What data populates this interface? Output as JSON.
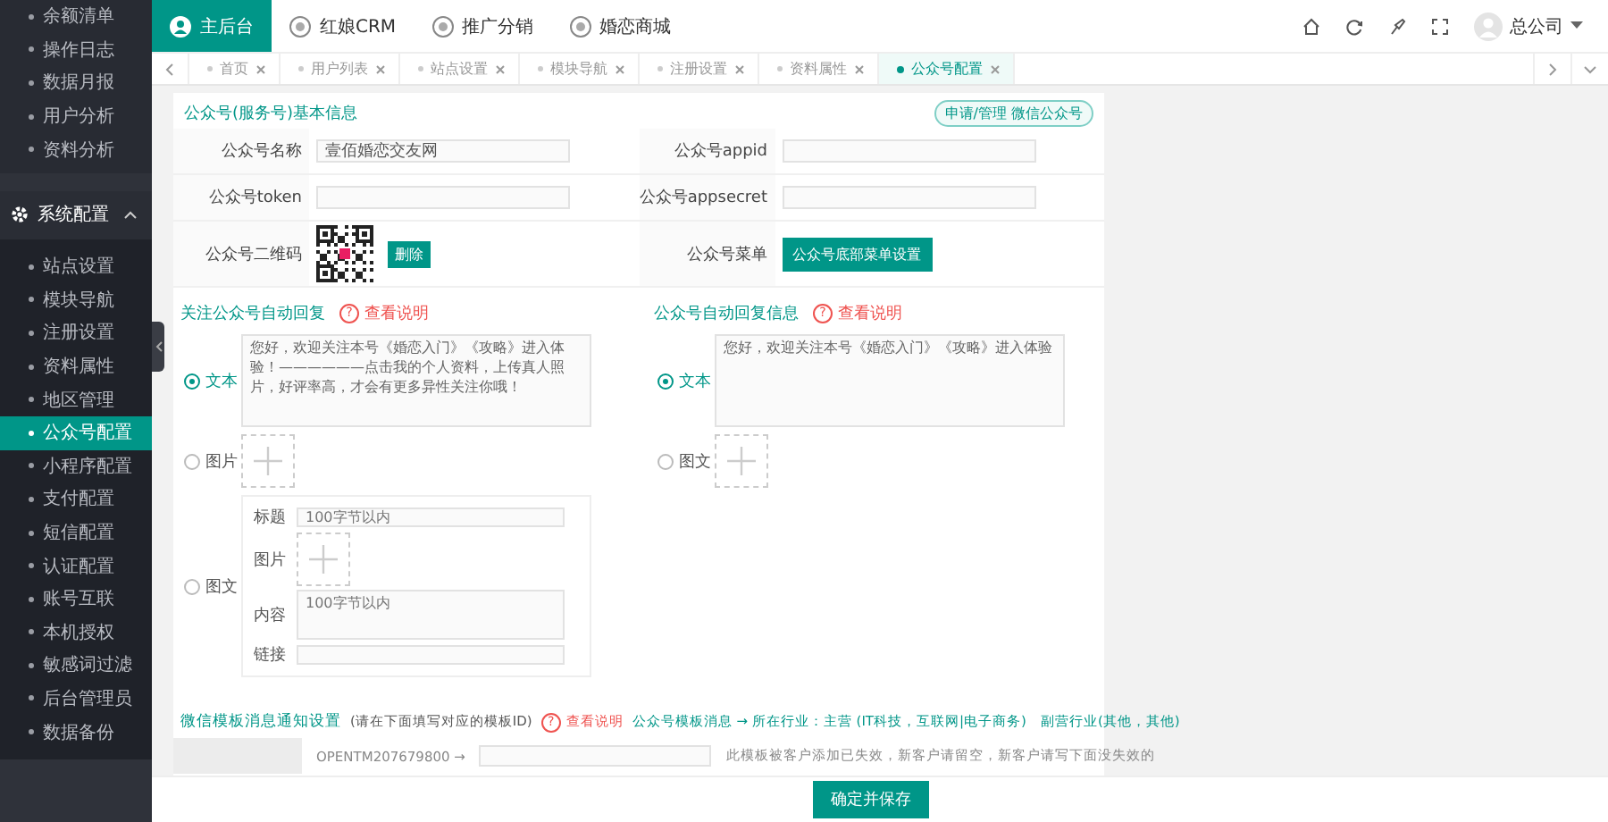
{
  "sidebar": {
    "items": [
      {
        "label": "余额清单",
        "selected": false
      },
      {
        "label": "操作日志",
        "selected": false
      },
      {
        "label": "数据月报",
        "selected": false
      },
      {
        "label": "用户分析",
        "selected": false
      },
      {
        "label": "资料分析",
        "selected": false
      }
    ],
    "section": {
      "label": "系统配置",
      "expanded": true,
      "children": [
        {
          "label": "站点设置",
          "selected": false
        },
        {
          "label": "模块导航",
          "selected": false
        },
        {
          "label": "注册设置",
          "selected": false
        },
        {
          "label": "资料属性",
          "selected": false
        },
        {
          "label": "地区管理",
          "selected": false
        },
        {
          "label": "公众号配置",
          "selected": true
        },
        {
          "label": "小程序配置",
          "selected": false
        },
        {
          "label": "支付配置",
          "selected": false
        },
        {
          "label": "短信配置",
          "selected": false
        },
        {
          "label": "认证配置",
          "selected": false
        },
        {
          "label": "账号互联",
          "selected": false
        },
        {
          "label": "本机授权",
          "selected": false
        },
        {
          "label": "敏感词过滤",
          "selected": false
        },
        {
          "label": "后台管理员",
          "selected": false
        },
        {
          "label": "数据备份",
          "selected": false
        }
      ]
    }
  },
  "modules": [
    {
      "label": "主后台",
      "selected": true
    },
    {
      "label": "红娘CRM",
      "selected": false
    },
    {
      "label": "推广分销",
      "selected": false
    },
    {
      "label": "婚恋商城",
      "selected": false
    }
  ],
  "user": {
    "name": "总公司"
  },
  "tabs": [
    {
      "label": "首页",
      "selected": false
    },
    {
      "label": "用户列表",
      "selected": false
    },
    {
      "label": "站点设置",
      "selected": false
    },
    {
      "label": "模块导航",
      "selected": false
    },
    {
      "label": "注册设置",
      "selected": false
    },
    {
      "label": "资料属性",
      "selected": false
    },
    {
      "label": "公众号配置",
      "selected": true
    }
  ],
  "basic": {
    "title": "公众号(服务号)基本信息",
    "apply_button": "申请/管理 微信公众号",
    "fields": [
      {
        "kind": "input",
        "label": "公众号名称",
        "value": "壹佰婚恋交友网"
      },
      {
        "kind": "input",
        "label": "公众号appid"
      },
      {
        "kind": "input",
        "label": "公众号token"
      },
      {
        "kind": "input",
        "label": "公众号appsecret"
      },
      {
        "kind": "qrcode",
        "label": "公众号二维码",
        "button": "删除"
      },
      {
        "kind": "button",
        "label": "公众号菜单",
        "button": "公众号底部菜单设置"
      }
    ]
  },
  "replies": [
    {
      "title": "关注公众号自动回复",
      "help": {
        "icon": "?",
        "label": "查看说明"
      },
      "options": [
        {
          "kind": "text",
          "label": "文本",
          "selected": true,
          "value": "您好，欢迎关注本号《婚恋入门》《攻略》进入体验！——————点击我的个人资料，上传真人照片，好评率高，才会有更多异性关注你哦！"
        },
        {
          "kind": "image",
          "label": "图片",
          "selected": false
        },
        {
          "kind": "news",
          "label": "图文",
          "selected": false,
          "fields": [
            {
              "kind": "input",
              "label": "标题",
              "placeholder": "100字节以内"
            },
            {
              "kind": "upload",
              "label": "图片"
            },
            {
              "kind": "textarea",
              "label": "内容",
              "placeholder": "100字节以内"
            },
            {
              "kind": "input",
              "label": "链接"
            }
          ]
        }
      ]
    },
    {
      "title": "公众号自动回复信息",
      "help": {
        "icon": "?",
        "label": "查看说明"
      },
      "options": [
        {
          "kind": "text",
          "label": "文本",
          "selected": true,
          "value": "您好，欢迎关注本号《婚恋入门》《攻略》进入体验"
        },
        {
          "kind": "image",
          "label": "图文",
          "selected": false
        }
      ]
    }
  ],
  "templates": {
    "title": "微信模板消息通知设置",
    "hint": "(请在下面填写对应的模板ID)",
    "help": {
      "icon": "?",
      "label": "查看说明"
    },
    "path": "公众号模板消息 → 所在行业：主营 (IT科技，互联网|电子商务)　副营行业(其他，其他)",
    "rows": [
      {
        "code": "OPENTM207679800 →",
        "note": "此模板被客户添加已失效，新客户请留空，新客户请写下面没失效的"
      }
    ]
  },
  "footer": {
    "save_button": "确定并保存"
  }
}
